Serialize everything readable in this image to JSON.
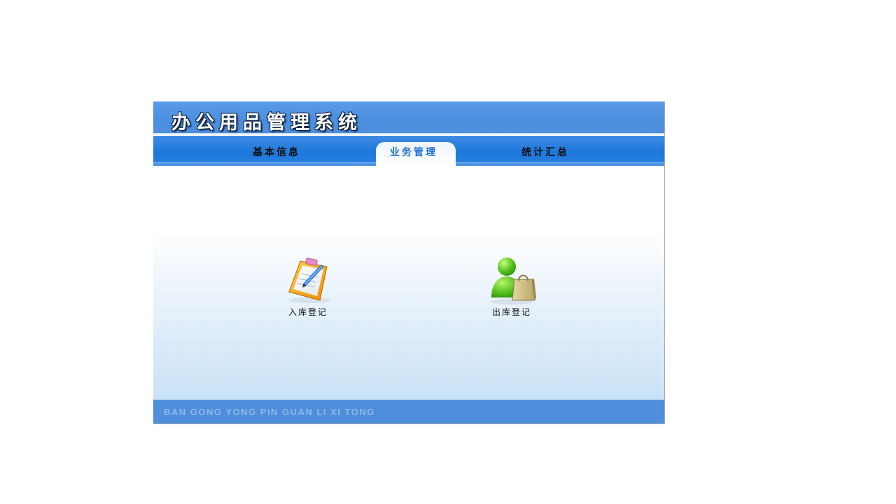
{
  "app": {
    "title": "办公用品管理系统"
  },
  "nav": {
    "tabs": [
      {
        "label": "基本信息",
        "active": false
      },
      {
        "label": "业务管理",
        "active": true
      },
      {
        "label": "统计汇总",
        "active": false
      }
    ]
  },
  "main": {
    "items": [
      {
        "label": "入库登记",
        "icon": "clipboard-pencil-icon"
      },
      {
        "label": "出库登记",
        "icon": "user-shopping-bag-icon"
      }
    ]
  },
  "footer": {
    "text": "BAN GONG YONG PIN GUAN LI XI TONG"
  },
  "colors": {
    "header_blue": "#4f8edb",
    "nav_blue": "#1c78dc",
    "active_tab_text": "#1d6fd1"
  }
}
